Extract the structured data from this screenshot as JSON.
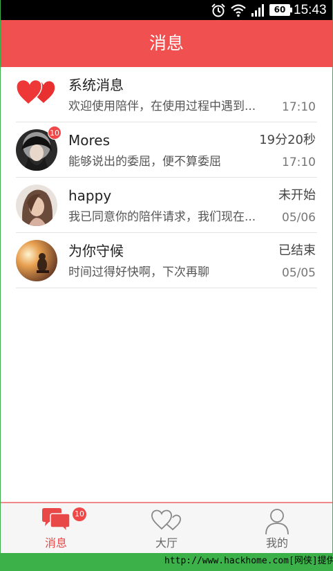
{
  "status_bar": {
    "battery": "60",
    "time": "15:43"
  },
  "header": {
    "title": "消息"
  },
  "messages": [
    {
      "name": "系统消息",
      "status": "",
      "preview": "欢迎使用陪伴，在使用过程中遇到...",
      "date": "17:10",
      "badge": "",
      "avatar": "hearts-icon"
    },
    {
      "name": "Mores",
      "status": "19分20秒",
      "preview": "能够说出的委屈，便不算委屈",
      "date": "17:10",
      "badge": "10",
      "avatar": "user-photo"
    },
    {
      "name": "happy",
      "status": "未开始",
      "preview": "我已同意你的陪伴请求，我们现在...",
      "date": "05/06",
      "badge": "",
      "avatar": "user-photo"
    },
    {
      "name": "为你守候",
      "status": "已结束",
      "preview": "时间过得好快啊，下次再聊",
      "date": "05/05",
      "badge": "",
      "avatar": "user-photo"
    }
  ],
  "tabbar": {
    "tabs": [
      {
        "label": "消息",
        "badge": "10",
        "active": true,
        "icon": "chat-bubbles-icon"
      },
      {
        "label": "大厅",
        "badge": "",
        "active": false,
        "icon": "hearts-outline-icon"
      },
      {
        "label": "我的",
        "badge": "",
        "active": false,
        "icon": "person-icon"
      }
    ]
  },
  "watermark": "http://www.hackhome.com[网侠]提供",
  "colors": {
    "accent": "#f05050",
    "badge": "#f04848",
    "frame_border": "#3cb14a"
  }
}
